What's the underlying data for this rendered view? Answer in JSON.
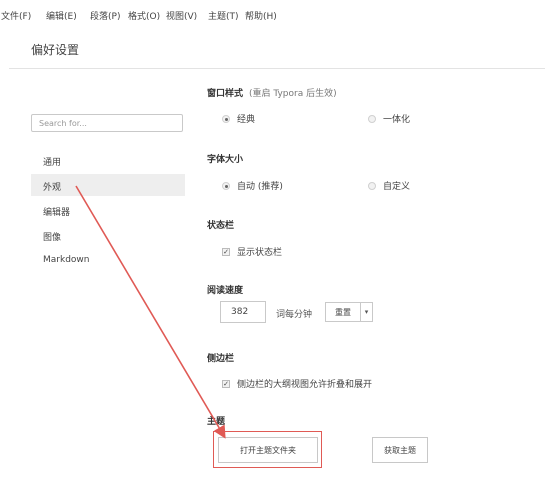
{
  "menu": [
    {
      "label": "文件(F)"
    },
    {
      "label": "编辑(E)"
    },
    {
      "label": "段落(P)"
    },
    {
      "label": "格式(O)"
    },
    {
      "label": "视图(V)"
    },
    {
      "label": "主题(T)"
    },
    {
      "label": "帮助(H)"
    }
  ],
  "page_title": "偏好设置",
  "search": {
    "placeholder": "Search for..."
  },
  "sidebar": {
    "items": [
      {
        "label": "通用"
      },
      {
        "label": "外观",
        "active": true
      },
      {
        "label": "编辑器"
      },
      {
        "label": "图像"
      },
      {
        "label": "Markdown"
      }
    ]
  },
  "window_style": {
    "title": "窗口样式",
    "note": "(重启 Typora 后生效)",
    "options": [
      {
        "label": "经典",
        "selected": true
      },
      {
        "label": "一体化",
        "selected": false
      }
    ]
  },
  "font_size": {
    "title": "字体大小",
    "options": [
      {
        "label": "自动 (推荐)",
        "selected": true
      },
      {
        "label": "自定义",
        "selected": false
      }
    ]
  },
  "status_bar": {
    "title": "状态栏",
    "checkbox_label": "显示状态栏",
    "checked": true
  },
  "reading_speed": {
    "title": "阅读速度",
    "value": "382",
    "unit_label": "词每分钟",
    "reset_label": "重置",
    "dropdown_glyph": "▾"
  },
  "sidebar_section": {
    "title": "侧边栏",
    "checkbox_label": "侧边栏的大纲视图允许折叠和展开",
    "checked": true
  },
  "theme": {
    "title": "主题",
    "open_folder_label": "打开主题文件夹",
    "get_themes_label": "获取主题"
  },
  "annotation": {
    "color": "#e05a55"
  }
}
